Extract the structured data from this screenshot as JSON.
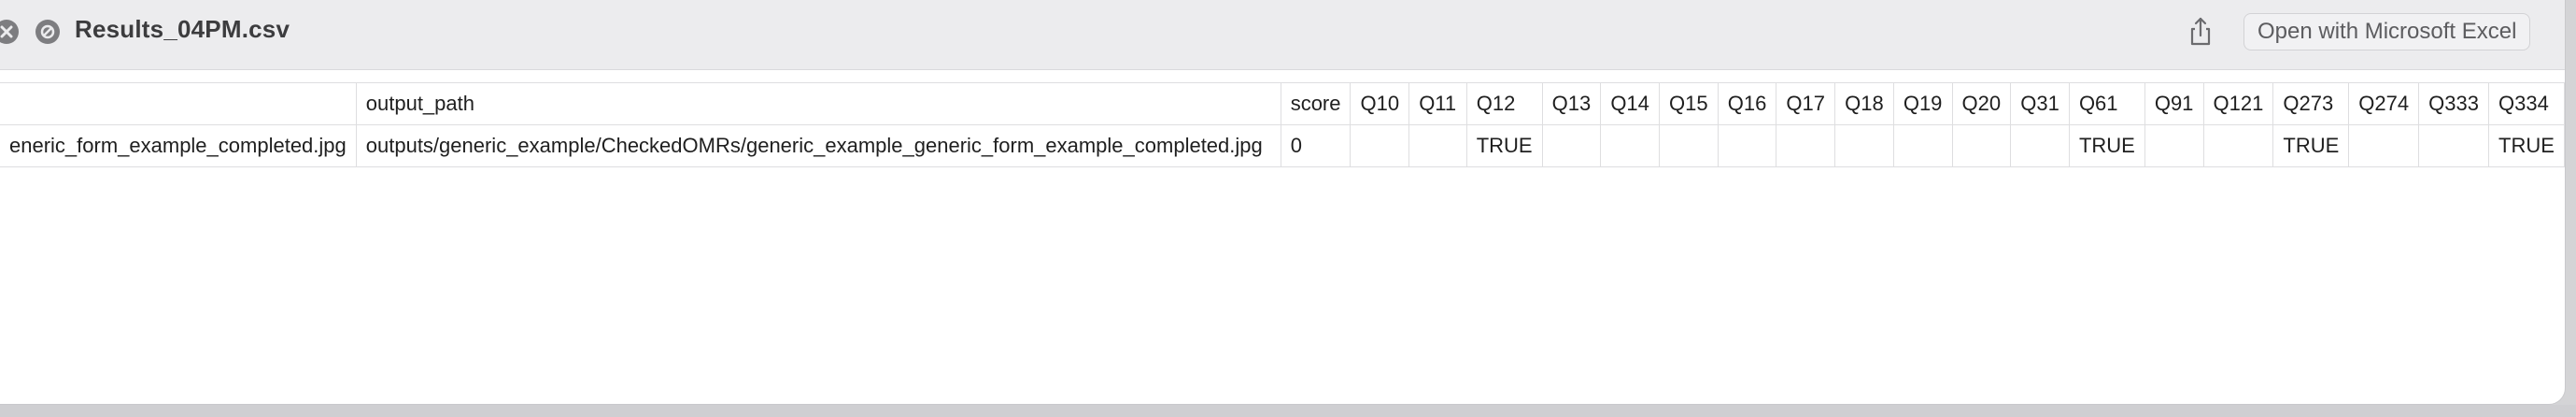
{
  "window": {
    "title": "Results_04PM.csv",
    "open_button_label": "Open with Microsoft Excel"
  },
  "table": {
    "headers": [
      "",
      "output_path",
      "score",
      "Q10",
      "Q11",
      "Q12",
      "Q13",
      "Q14",
      "Q15",
      "Q16",
      "Q17",
      "Q18",
      "Q19",
      "Q20",
      "Q31",
      "Q61",
      "Q91",
      "Q121",
      "Q273",
      "Q274",
      "Q333",
      "Q334"
    ],
    "rows": [
      [
        "eneric_form_example_completed.jpg",
        "outputs/generic_example/CheckedOMRs/generic_example_generic_form_example_completed.jpg",
        "0",
        "",
        "",
        "TRUE",
        "",
        "",
        "",
        "",
        "",
        "",
        "",
        "",
        "",
        "TRUE",
        "",
        "",
        "TRUE",
        "",
        "",
        "TRUE"
      ]
    ]
  },
  "icons": {
    "close": "close-icon",
    "stop": "stop-icon",
    "share": "share-icon"
  }
}
